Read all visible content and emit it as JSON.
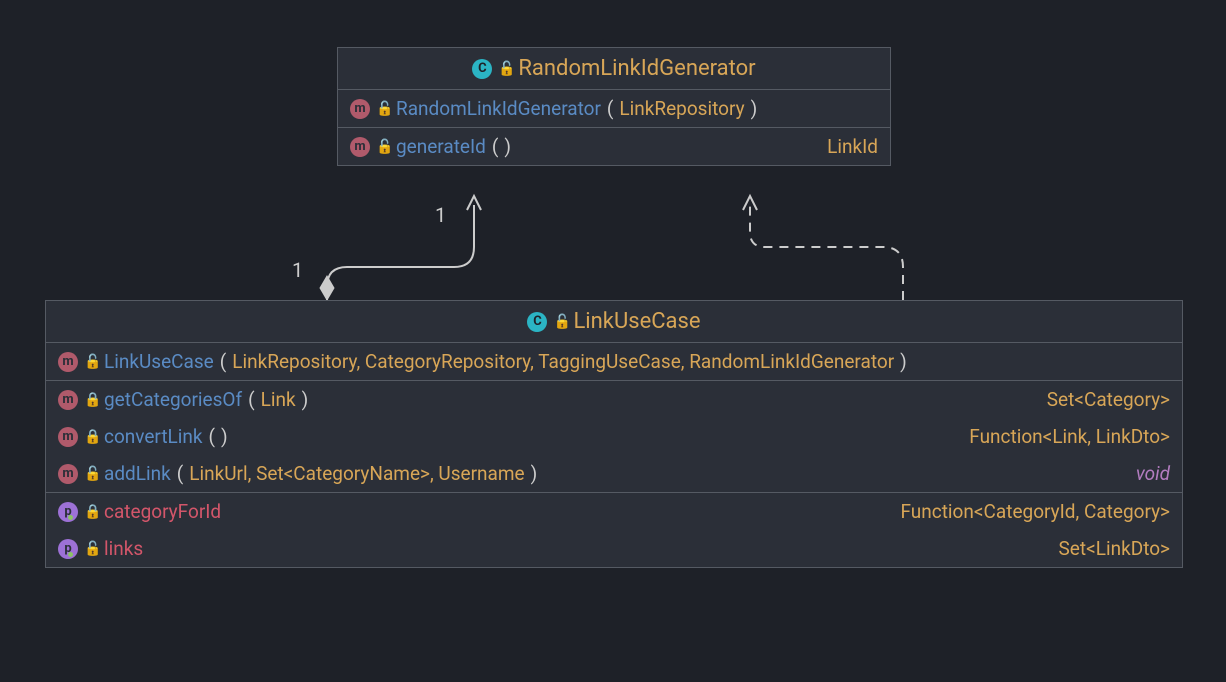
{
  "class1": {
    "title": "RandomLinkIdGenerator",
    "rows": [
      {
        "badge": "m",
        "lock": "green",
        "name": "RandomLinkIdGenerator",
        "nameClass": "name-blue",
        "paramsPrefix": "(",
        "params": "LinkRepository",
        "paramsSuffix": ")",
        "ret": "",
        "retClass": ""
      },
      {
        "badge": "m",
        "lock": "green",
        "name": "generateId",
        "nameClass": "name-blue",
        "paramsPrefix": "(",
        "params": "",
        "paramsSuffix": ")",
        "ret": "LinkId",
        "retClass": "type-gold"
      }
    ]
  },
  "class2": {
    "title": "LinkUseCase",
    "section1": [
      {
        "badge": "m",
        "lock": "green",
        "name": "LinkUseCase",
        "nameClass": "name-blue",
        "paramsPrefix": "(",
        "params": "LinkRepository, CategoryRepository, TaggingUseCase, RandomLinkIdGenerator",
        "paramsSuffix": ")",
        "ret": "",
        "retClass": ""
      }
    ],
    "section2": [
      {
        "badge": "m",
        "lock": "orange",
        "name": "getCategoriesOf",
        "nameClass": "name-blue",
        "paramsPrefix": "(",
        "params": "Link",
        "paramsSuffix": ")",
        "ret": "Set<Category>",
        "retClass": "type-gold"
      },
      {
        "badge": "m",
        "lock": "orange",
        "name": "convertLink",
        "nameClass": "name-blue",
        "paramsPrefix": "(",
        "params": "",
        "paramsSuffix": ")",
        "ret": "Function<Link, LinkDto>",
        "retClass": "type-gold"
      },
      {
        "badge": "m",
        "lock": "green",
        "name": "addLink",
        "nameClass": "name-blue",
        "paramsPrefix": "(",
        "params": "LinkUrl, Set<CategoryName>, Username",
        "paramsSuffix": ")",
        "ret": "void",
        "retClass": "type-italic"
      }
    ],
    "section3": [
      {
        "badge": "p",
        "lock": "orange",
        "name": "categoryForId",
        "nameClass": "name-red",
        "paramsPrefix": "",
        "params": "",
        "paramsSuffix": "",
        "ret": "Function<CategoryId, Category>",
        "retClass": "type-gold",
        "dot": true
      },
      {
        "badge": "p",
        "lock": "green",
        "name": "links",
        "nameClass": "name-red",
        "paramsPrefix": "",
        "params": "",
        "paramsSuffix": "",
        "ret": "Set<LinkDto>",
        "retClass": "type-gold",
        "dot": true
      }
    ]
  },
  "multiplicity": {
    "top": "1",
    "bottom": "1"
  }
}
